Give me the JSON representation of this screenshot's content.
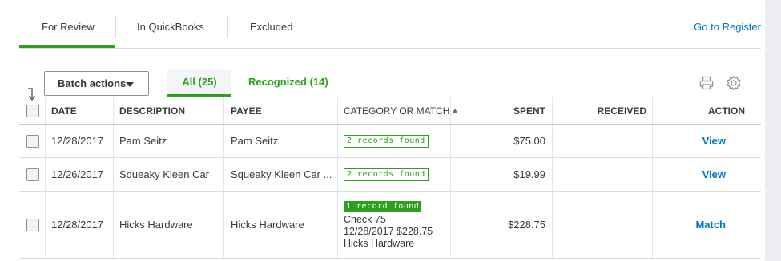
{
  "tabs": {
    "for_review": "For Review",
    "in_quickbooks": "In QuickBooks",
    "excluded": "Excluded"
  },
  "go_to_register": "Go to Register",
  "toolbar": {
    "batch_actions": "Batch actions",
    "filter_all": "All (25)",
    "filter_recognized": "Recognized (14)",
    "print_icon": "print-icon",
    "settings_icon": "gear-icon"
  },
  "table": {
    "headers": {
      "date": "DATE",
      "description": "DESCRIPTION",
      "payee": "PAYEE",
      "category": "CATEGORY OR MATCH",
      "spent": "SPENT",
      "received": "RECEIVED",
      "action": "ACTION"
    },
    "rows": [
      {
        "date": "12/28/2017",
        "description": "Pam Seitz",
        "payee": "Pam Seitz",
        "badge": "2 records found",
        "spent": "$75.00",
        "received": "",
        "action": "View"
      },
      {
        "date": "12/26/2017",
        "description": "Squeaky Kleen Car",
        "payee": "Squeaky Kleen Car ...",
        "badge": "2 records found",
        "spent": "$19.99",
        "received": "",
        "action": "View"
      },
      {
        "date": "12/28/2017",
        "description": "Hicks Hardware",
        "payee": "Hicks Hardware",
        "badge": "1 record found",
        "match_line1": "Check 75",
        "match_line2": "12/28/2017 $228.75",
        "match_line3": "Hicks Hardware",
        "spent": "$228.75",
        "received": "",
        "action": "Match"
      }
    ]
  },
  "colors": {
    "accent_green": "#2ca01c",
    "link_blue": "#0077c5"
  }
}
